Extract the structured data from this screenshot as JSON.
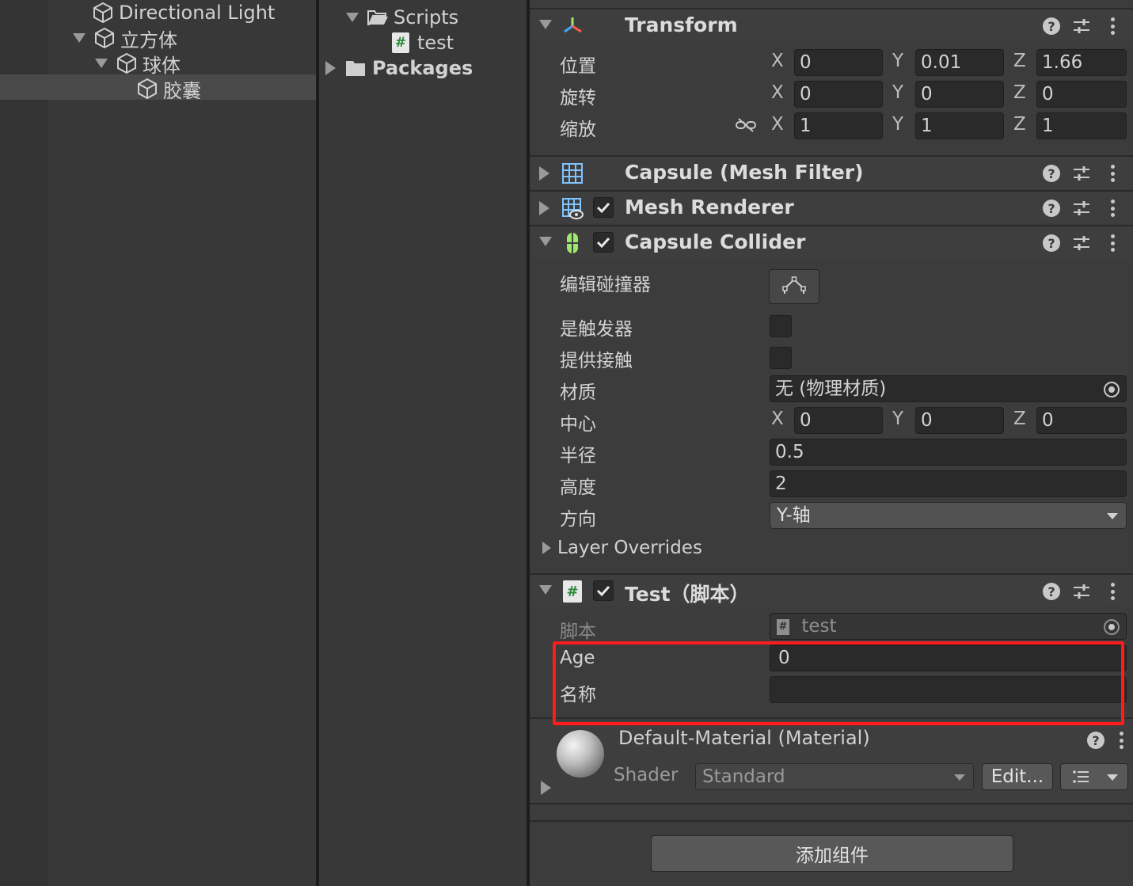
{
  "hierarchy": {
    "items": [
      {
        "label": "Directional Light"
      },
      {
        "label": "立方体"
      },
      {
        "label": "球体"
      },
      {
        "label": "胶囊"
      }
    ]
  },
  "project": {
    "items": [
      {
        "label": "Scripts"
      },
      {
        "label": "test"
      },
      {
        "label": "Packages"
      }
    ]
  },
  "inspector": {
    "transform": {
      "title": "Transform",
      "position_label": "位置",
      "rotation_label": "旋转",
      "scale_label": "缩放",
      "axes": [
        "X",
        "Y",
        "Z"
      ],
      "position": [
        "0",
        "0.01",
        "1.66"
      ],
      "rotation": [
        "0",
        "0",
        "0"
      ],
      "scale": [
        "1",
        "1",
        "1"
      ]
    },
    "mesh_filter": {
      "title": "Capsule (Mesh Filter)"
    },
    "mesh_renderer": {
      "title": "Mesh Renderer"
    },
    "capsule_collider": {
      "title": "Capsule Collider",
      "edit_collider_label": "编辑碰撞器",
      "is_trigger_label": "是触发器",
      "provides_contacts_label": "提供接触",
      "material_label": "材质",
      "material_value": "无 (物理材质)",
      "center_label": "中心",
      "center": [
        "0",
        "0",
        "0"
      ],
      "radius_label": "半径",
      "radius": "0.5",
      "height_label": "高度",
      "height": "2",
      "direction_label": "方向",
      "direction": "Y-轴",
      "layer_overrides_label": "Layer Overrides"
    },
    "test_script": {
      "title": "Test（脚本）",
      "script_label": "脚本",
      "script_value": "test",
      "age_label": "Age",
      "age_value": "0",
      "name_label": "名称",
      "name_value": ""
    },
    "material": {
      "title": "Default-Material (Material)",
      "shader_label": "Shader",
      "shader_value": "Standard",
      "edit_button": "Edit..."
    },
    "add_component_button": "添加组件"
  },
  "colors": {
    "highlight": "#ff1c1c",
    "check_green": "#9be86a"
  }
}
